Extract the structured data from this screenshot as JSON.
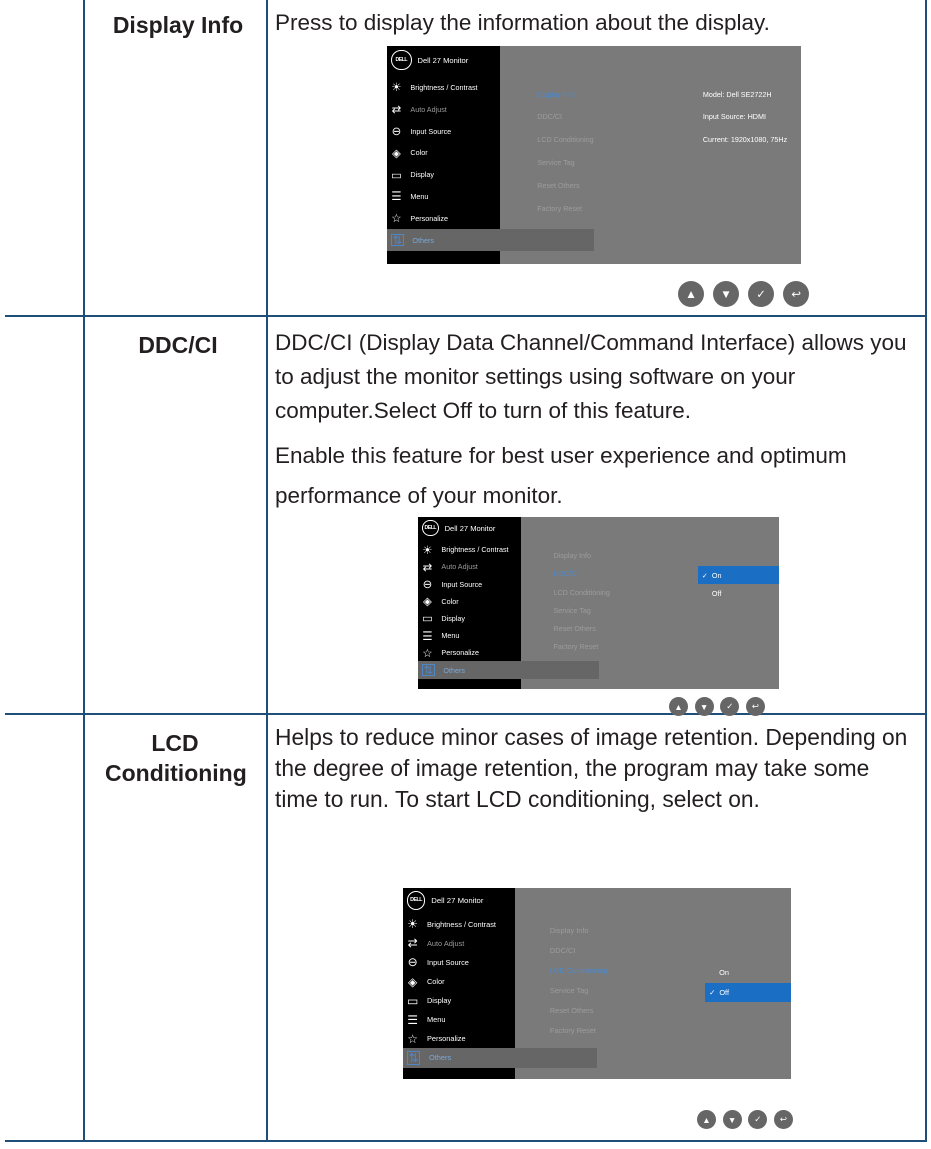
{
  "rows": [
    {
      "label": "Display Info",
      "paragraphs": [
        "Press to display the information about the display."
      ],
      "osd": {
        "title": "Dell 27 Monitor",
        "logo": "DELL",
        "menu": [
          "Brightness / Contrast",
          "Auto Adjust",
          "Input Source",
          "Color",
          "Display",
          "Menu",
          "Personalize",
          "Others"
        ],
        "submenu": [
          "Display Info",
          "DDC/CI",
          "LCD Conditioning",
          "Service Tag",
          "Reset Others",
          "Factory Reset"
        ],
        "values": [
          "Model: Dell SE2722H",
          "Input Source: HDMI",
          "Current: 1920x1080, 75Hz"
        ]
      }
    },
    {
      "label": "DDC/CI",
      "paragraphs": [
        "DDC/CI (Display Data Channel/Command Interface) allows you to adjust the monitor settings using software on your computer.Select Off to turn of this feature.",
        "Enable this feature for best user experience and optimum performance of your monitor."
      ],
      "osd": {
        "title": "Dell 27 Monitor",
        "logo": "DELL",
        "menu": [
          "Brightness / Contrast",
          "Auto Adjust",
          "Input Source",
          "Color",
          "Display",
          "Menu",
          "Personalize",
          "Others"
        ],
        "submenu": [
          "Display Info",
          "DDC/CI",
          "LCD Conditioning",
          "Service Tag",
          "Reset Others",
          "Factory Reset"
        ],
        "options": [
          "On",
          "Off"
        ],
        "selected_option": "On"
      }
    },
    {
      "label": "LCD Conditioning",
      "paragraphs": [
        "Helps to reduce minor cases of image retention. Depending on the degree of image retention, the program may take some time to run. To start LCD conditioning, select on."
      ],
      "osd": {
        "title": "Dell 27 Monitor",
        "logo": "DELL",
        "menu": [
          "Brightness / Contrast",
          "Auto Adjust",
          "Input Source",
          "Color",
          "Display",
          "Menu",
          "Personalize",
          "Others"
        ],
        "submenu": [
          "Display Info",
          "DDC/CI",
          "LCD Conditioning",
          "Service Tag",
          "Reset Others",
          "Factory Reset"
        ],
        "options": [
          "On",
          "Off"
        ],
        "selected_option": "Off"
      }
    }
  ],
  "checkmark": "✓",
  "menu_icons": [
    "brightness-icon",
    "auto-adjust-icon",
    "input-source-icon",
    "color-icon",
    "display-icon",
    "menu-icon",
    "personalize-icon",
    "others-icon"
  ],
  "nav_icons": [
    "up-icon",
    "down-icon",
    "check-icon",
    "back-icon"
  ],
  "colors": {
    "border": "#1f4f78",
    "osd_bg": "#7a7a7a",
    "osd_left": "#000000",
    "highlight": "#1a6fc4"
  }
}
